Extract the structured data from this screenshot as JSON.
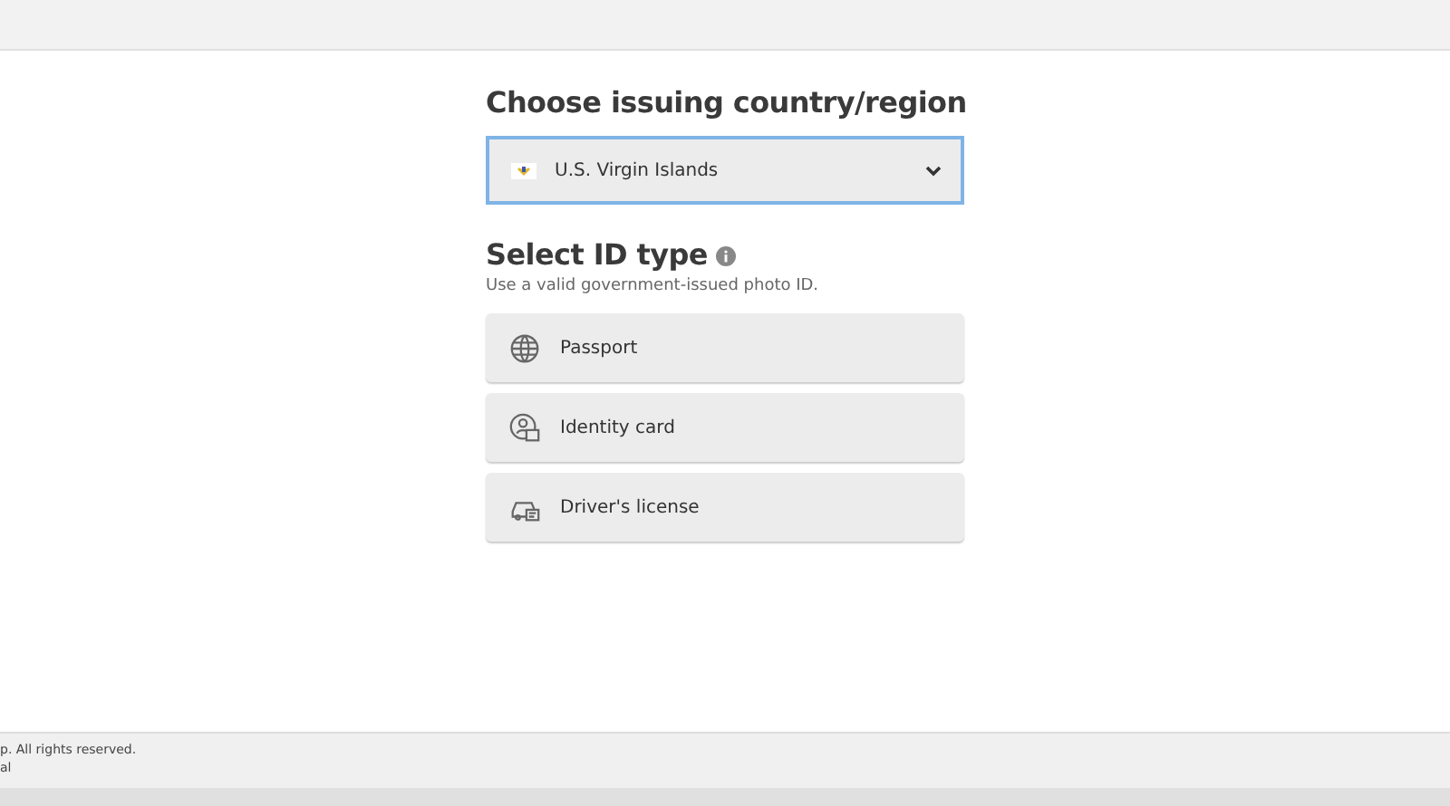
{
  "country": {
    "heading": "Choose issuing country/region",
    "value": "U.S. Virgin Islands"
  },
  "id_type": {
    "heading": "Select ID type",
    "hint": "Use a valid government-issued photo ID.",
    "options": [
      {
        "kind": "passport",
        "label": "Passport"
      },
      {
        "kind": "identity",
        "label": "Identity card"
      },
      {
        "kind": "driver",
        "label": "Driver's license"
      }
    ]
  },
  "footer": {
    "lines": [
      "p. All rights reserved.",
      "al"
    ]
  }
}
